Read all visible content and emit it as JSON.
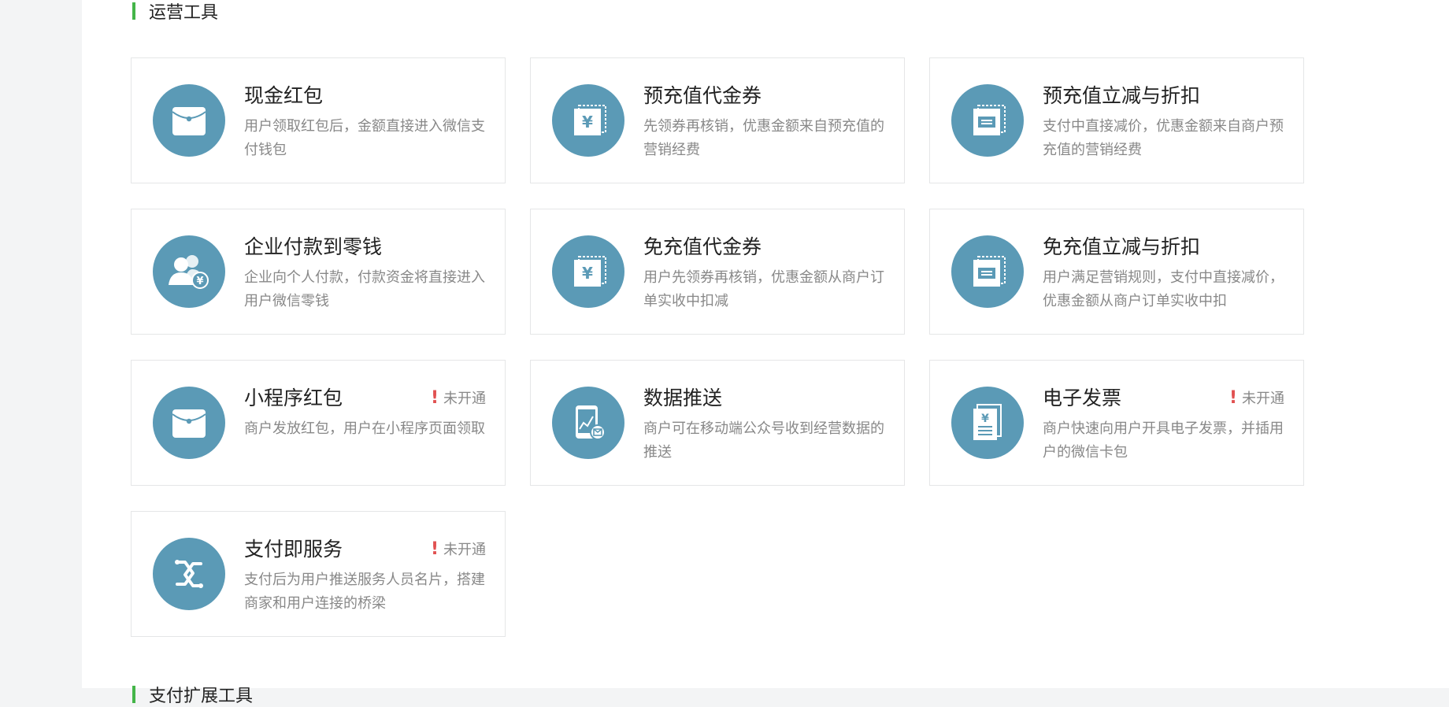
{
  "section": {
    "title": "运营工具",
    "next_title": "支付扩展工具"
  },
  "colors": {
    "accent": "#44b549",
    "icon_bg": "#5b9ab6",
    "warning": "#e15050"
  },
  "tools": [
    {
      "title": "现金红包",
      "desc": "用户领取红包后，金额直接进入微信支付钱包",
      "icon": "red-envelope-icon",
      "status": ""
    },
    {
      "title": "预充值代金券",
      "desc": "先领券再核销，优惠金额来自预充值的营销经费",
      "icon": "yuan-voucher-icon",
      "status": ""
    },
    {
      "title": "预充值立减与折扣",
      "desc": "支付中直接减价，优惠金额来自商户预充值的营销经费",
      "icon": "discount-ticket-icon",
      "status": ""
    },
    {
      "title": "企业付款到零钱",
      "desc": "企业向个人付款，付款资金将直接进入用户微信零钱",
      "icon": "enterprise-payment-icon",
      "status": ""
    },
    {
      "title": "免充值代金券",
      "desc": "用户先领券再核销，优惠金额从商户订单实收中扣减",
      "icon": "yuan-voucher-icon",
      "status": ""
    },
    {
      "title": "免充值立减与折扣",
      "desc": "用户满足营销规则，支付中直接减价，优惠金额从商户订单实收中扣",
      "icon": "discount-ticket-icon",
      "status": ""
    },
    {
      "title": "小程序红包",
      "desc": "商户发放红包，用户在小程序页面领取",
      "icon": "red-envelope-icon",
      "status": "未开通"
    },
    {
      "title": "数据推送",
      "desc": "商户可在移动端公众号收到经营数据的推送",
      "icon": "data-push-icon",
      "status": ""
    },
    {
      "title": "电子发票",
      "desc": "商户快速向用户开具电子发票，并插用户的微信卡包",
      "icon": "invoice-icon",
      "status": "未开通"
    },
    {
      "title": "支付即服务",
      "desc": "支付后为用户推送服务人员名片，搭建商家和用户连接的桥梁",
      "icon": "link-service-icon",
      "status": "未开通"
    }
  ]
}
